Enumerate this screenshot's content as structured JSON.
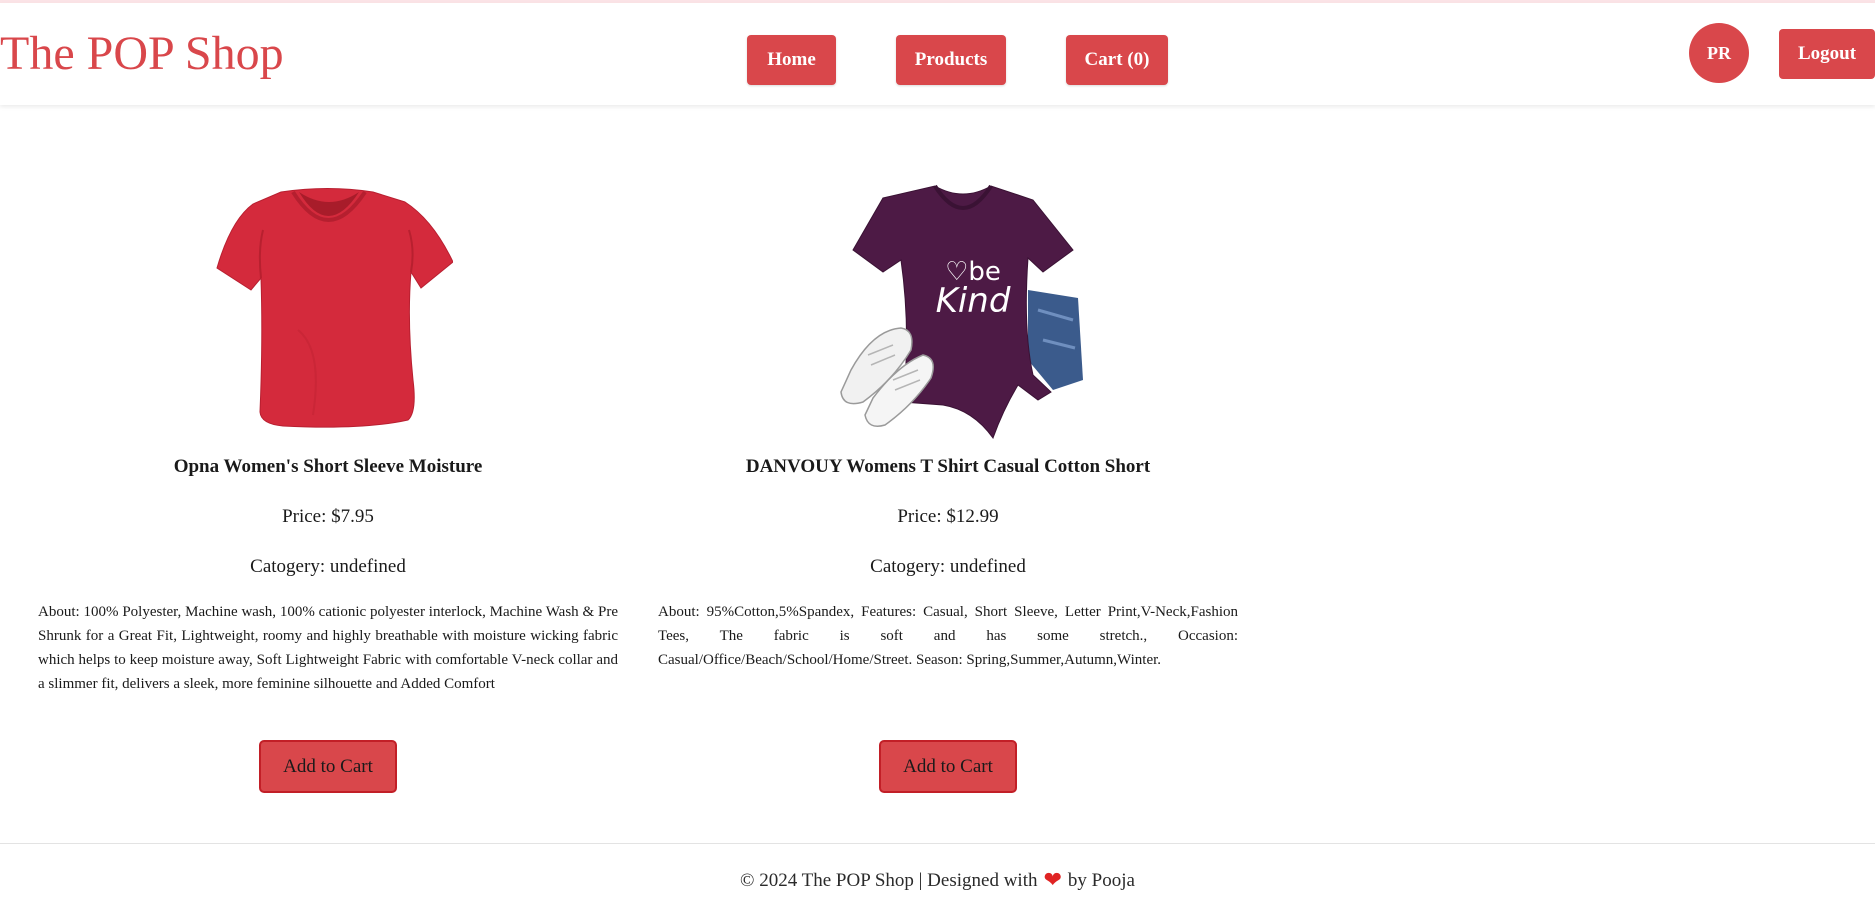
{
  "header": {
    "brand": "The POP Shop",
    "nav": {
      "home": "Home",
      "products": "Products",
      "cart": "Cart (0)"
    },
    "avatar_initials": "PR",
    "logout": "Logout"
  },
  "products": [
    {
      "image": "red-v-neck-tshirt",
      "title": "Opna Women's Short Sleeve Moisture",
      "price": "Price: $7.95",
      "category": "Catogery: undefined",
      "about": "About: 100% Polyester, Machine wash, 100% cationic polyester interlock, Machine Wash & Pre Shrunk for a Great Fit, Lightweight, roomy and highly breathable with moisture wicking fabric which helps to keep moisture away, Soft Lightweight Fabric with comfortable V-neck collar and a slimmer fit, delivers a sleek, more feminine silhouette and Added Comfort",
      "button": "Add to Cart"
    },
    {
      "image": "purple-be-kind-tshirt",
      "image_text": "be Kind",
      "title": "DANVOUY Womens T Shirt Casual Cotton Short",
      "price": "Price: $12.99",
      "category": "Catogery: undefined",
      "about": "About: 95%Cotton,5%Spandex, Features: Casual, Short Sleeve, Letter Print,V-Neck,Fashion Tees, The fabric is soft and has some stretch., Occasion: Casual/Office/Beach/School/Home/Street. Season: Spring,Summer,Autumn,Winter.",
      "button": "Add to Cart"
    }
  ],
  "footer": {
    "prefix": "© 2024 The POP Shop | Designed with",
    "icon": "heart-icon",
    "suffix": "by Pooja"
  },
  "colors": {
    "accent": "#d9474b",
    "button_border": "#c21f27",
    "heart": "#e02424",
    "shirt_red": "#d42a3c",
    "shirt_purple": "#4d1a45"
  }
}
